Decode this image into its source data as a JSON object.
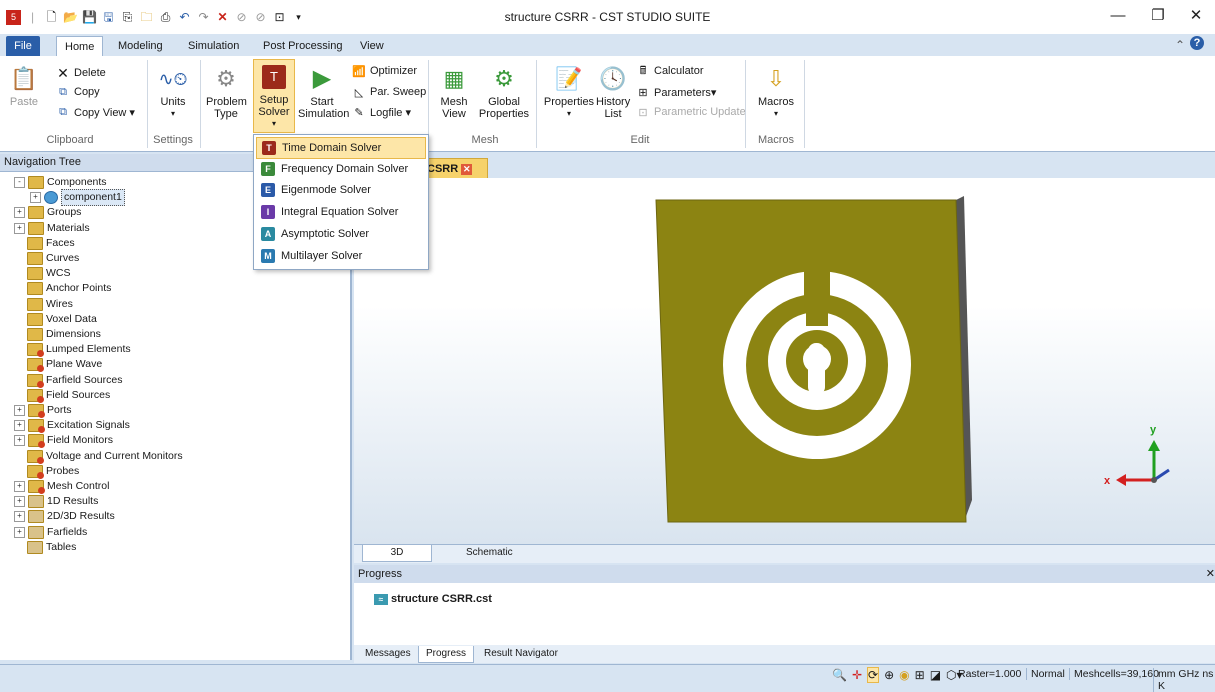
{
  "window": {
    "title": "structure CSRR - CST STUDIO SUITE"
  },
  "tabs": [
    "File",
    "Home",
    "Modeling",
    "Simulation",
    "Post Processing",
    "View"
  ],
  "ribbon": {
    "clipboard": {
      "paste": "Paste",
      "delete": "Delete",
      "copy": "Copy",
      "copy_view": "Copy View ▾",
      "label": "Clipboard"
    },
    "settings": {
      "units": "Units",
      "label": "Settings"
    },
    "simulation": {
      "problem_type": "Problem Type",
      "setup_solver": "Setup Solver",
      "start_simulation": "Start Simulation",
      "optimizer": "Optimizer",
      "par_sweep": "Par. Sweep",
      "logfile": "Logfile ▾"
    },
    "mesh": {
      "mesh_view": "Mesh View",
      "global_properties": "Global Properties",
      "label": "Mesh"
    },
    "edit": {
      "properties": "Properties",
      "history_list": "History List",
      "calculator": "Calculator",
      "parameters": "Parameters▾",
      "parametric_update": "Parametric Update",
      "label": "Edit"
    },
    "macros": {
      "macros": "Macros",
      "label": "Macros"
    }
  },
  "solver_menu": [
    {
      "label": "Time Domain Solver",
      "letter": "T",
      "color": "#9c2a1a"
    },
    {
      "label": "Frequency Domain Solver",
      "letter": "F",
      "color": "#3b8a3b"
    },
    {
      "label": "Eigenmode Solver",
      "letter": "E",
      "color": "#2b5aa8"
    },
    {
      "label": "Integral Equation Solver",
      "letter": "I",
      "color": "#6a3aa8"
    },
    {
      "label": "Asymptotic Solver",
      "letter": "A",
      "color": "#2a8aa0"
    },
    {
      "label": "Multilayer Solver",
      "letter": "M",
      "color": "#2a7ab0"
    }
  ],
  "nav": {
    "header": "Navigation Tree",
    "items": [
      "Components",
      "component1",
      "Groups",
      "Materials",
      "Faces",
      "Curves",
      "WCS",
      "Anchor Points",
      "Wires",
      "Voxel Data",
      "Dimensions",
      "Lumped Elements",
      "Plane Wave",
      "Farfield Sources",
      "Field Sources",
      "Ports",
      "Excitation Signals",
      "Field Monitors",
      "Voltage and Current Monitors",
      "Probes",
      "Mesh Control",
      "1D Results",
      "2D/3D Results",
      "Farfields",
      "Tables"
    ]
  },
  "view": {
    "doc_tab": "CSRR",
    "tab_3d": "3D",
    "tab_schematic": "Schematic",
    "axis_x": "x",
    "axis_y": "y"
  },
  "progress": {
    "header": "Progress",
    "file": "structure CSRR.cst"
  },
  "bottom_tabs": [
    "Messages",
    "Progress",
    "Result Navigator"
  ],
  "status": {
    "raster": "Raster=1.000",
    "mode": "Normal",
    "meshcells": "Meshcells=39,160",
    "units": "mm GHz ns K"
  },
  "colors": {
    "substrate": "#8c8412",
    "accent": "#2a5ea8"
  }
}
